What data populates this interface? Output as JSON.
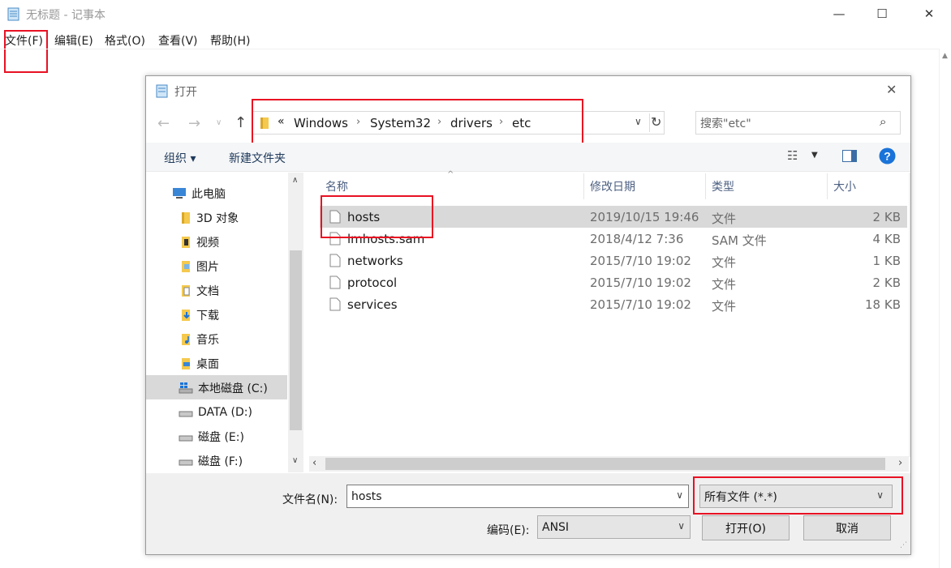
{
  "window": {
    "title": "无标题 - 记事本",
    "minimize_glyph": "—",
    "maximize_glyph": "☐",
    "close_glyph": "✕"
  },
  "menu": [
    {
      "label": "文件(F)"
    },
    {
      "label": "编辑(E)"
    },
    {
      "label": "格式(O)"
    },
    {
      "label": "查看(V)"
    },
    {
      "label": "帮助(H)"
    }
  ],
  "dialog": {
    "title": "打开",
    "breadcrumb": [
      "«",
      "Windows",
      "System32",
      "drivers",
      "etc"
    ],
    "search_placeholder": "搜索\"etc\"",
    "toolbar": {
      "organize": "组织 ▾",
      "new_folder": "新建文件夹"
    },
    "nav": [
      {
        "label": "此电脑",
        "icon": "computer-icon"
      },
      {
        "label": "3D 对象",
        "icon": "folder-3d-icon"
      },
      {
        "label": "视频",
        "icon": "folder-video-icon"
      },
      {
        "label": "图片",
        "icon": "folder-pictures-icon"
      },
      {
        "label": "文档",
        "icon": "folder-documents-icon"
      },
      {
        "label": "下载",
        "icon": "folder-downloads-icon"
      },
      {
        "label": "音乐",
        "icon": "folder-music-icon"
      },
      {
        "label": "桌面",
        "icon": "folder-desktop-icon"
      },
      {
        "label": "本地磁盘 (C:)",
        "icon": "drive-c-icon"
      },
      {
        "label": "DATA (D:)",
        "icon": "drive-icon"
      },
      {
        "label": "磁盘 (E:)",
        "icon": "drive-icon"
      },
      {
        "label": "磁盘 (F:)",
        "icon": "drive-icon"
      }
    ],
    "columns": {
      "name": "名称",
      "modified": "修改日期",
      "type": "类型",
      "size": "大小"
    },
    "files": [
      {
        "name": "hosts",
        "modified": "2019/10/15 19:46",
        "type": "文件",
        "size": "2 KB"
      },
      {
        "name": "lmhosts.sam",
        "modified": "2018/4/12 7:36",
        "type": "SAM 文件",
        "size": "4 KB"
      },
      {
        "name": "networks",
        "modified": "2015/7/10 19:02",
        "type": "文件",
        "size": "1 KB"
      },
      {
        "name": "protocol",
        "modified": "2015/7/10 19:02",
        "type": "文件",
        "size": "2 KB"
      },
      {
        "name": "services",
        "modified": "2015/7/10 19:02",
        "type": "文件",
        "size": "18 KB"
      }
    ],
    "filename_label": "文件名(N):",
    "filename_value": "hosts",
    "filetype_value": "所有文件  (*.*)",
    "encoding_label": "编码(E):",
    "encoding_value": "ANSI",
    "open_button": "打开(O)",
    "cancel_button": "取消"
  },
  "colors": {
    "highlight_red": "#e81123",
    "selected_row": "#d9d9d9",
    "accent_blue": "#1a73d9"
  }
}
